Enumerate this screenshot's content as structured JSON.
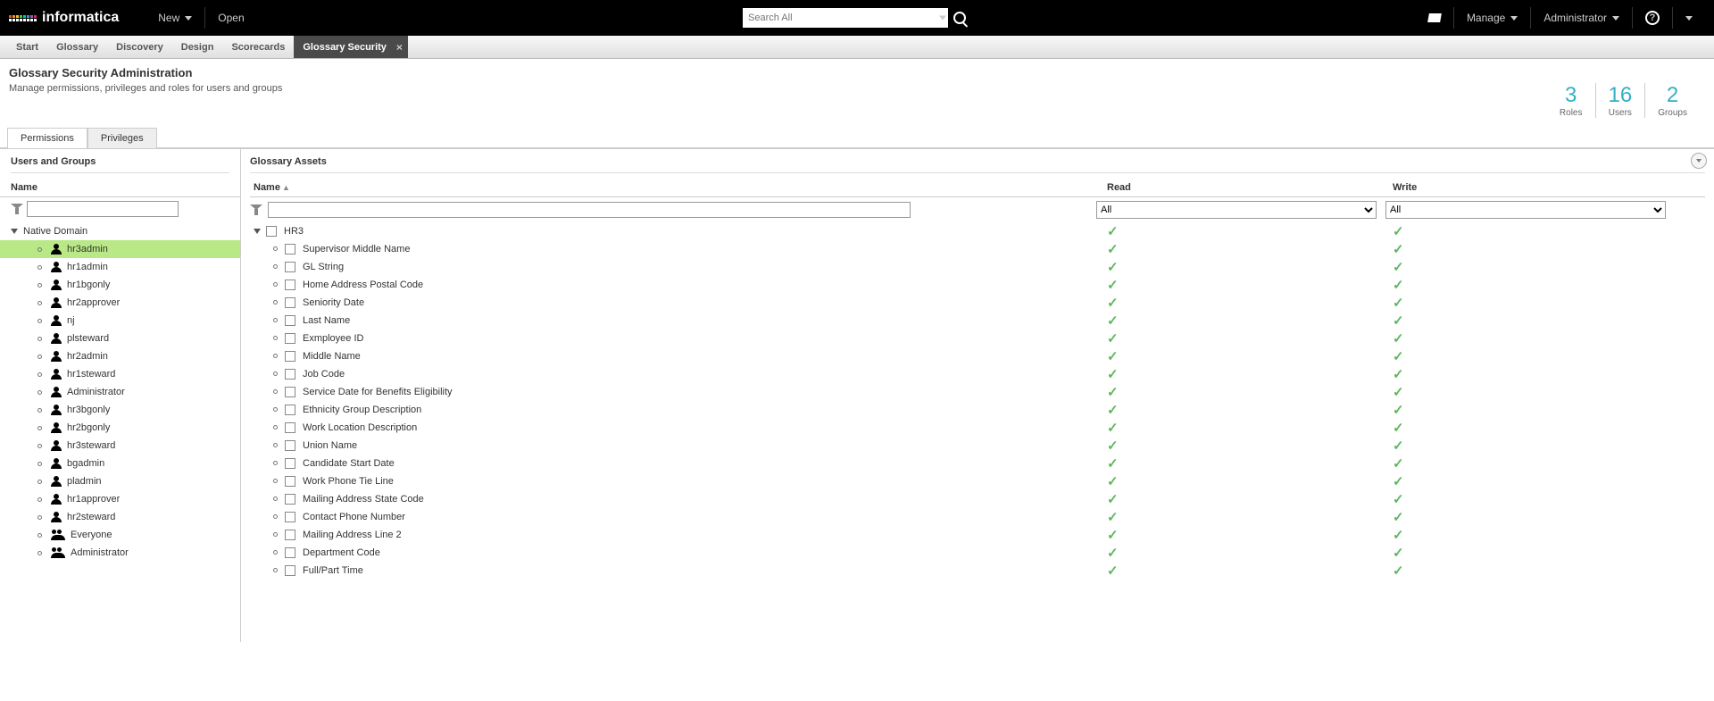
{
  "header": {
    "brand": "informatica",
    "new_label": "New",
    "open_label": "Open",
    "search_placeholder": "Search All",
    "manage_label": "Manage",
    "admin_label": "Administrator",
    "help_glyph": "?"
  },
  "nav": {
    "tabs": [
      {
        "label": "Start",
        "active": false
      },
      {
        "label": "Glossary",
        "active": false
      },
      {
        "label": "Discovery",
        "active": false
      },
      {
        "label": "Design",
        "active": false
      },
      {
        "label": "Scorecards",
        "active": false
      },
      {
        "label": "Glossary Security",
        "active": true
      }
    ]
  },
  "page": {
    "title": "Glossary Security Administration",
    "subtitle": "Manage permissions, privileges and roles for users and groups",
    "stats": [
      {
        "num": "3",
        "label": "Roles"
      },
      {
        "num": "16",
        "label": "Users"
      },
      {
        "num": "2",
        "label": "Groups"
      }
    ],
    "subtabs": [
      {
        "label": "Permissions",
        "active": true
      },
      {
        "label": "Privileges",
        "active": false
      }
    ]
  },
  "left": {
    "title": "Users and Groups",
    "name_header": "Name",
    "domain": "Native Domain",
    "items": [
      {
        "name": "hr3admin",
        "type": "user",
        "selected": true
      },
      {
        "name": "hr1admin",
        "type": "user"
      },
      {
        "name": "hr1bgonly",
        "type": "user"
      },
      {
        "name": "hr2approver",
        "type": "user"
      },
      {
        "name": "nj",
        "type": "user"
      },
      {
        "name": "plsteward",
        "type": "user"
      },
      {
        "name": "hr2admin",
        "type": "user"
      },
      {
        "name": "hr1steward",
        "type": "user"
      },
      {
        "name": "Administrator",
        "type": "user"
      },
      {
        "name": "hr3bgonly",
        "type": "user"
      },
      {
        "name": "hr2bgonly",
        "type": "user"
      },
      {
        "name": "hr3steward",
        "type": "user"
      },
      {
        "name": "bgadmin",
        "type": "user"
      },
      {
        "name": "pladmin",
        "type": "user"
      },
      {
        "name": "hr1approver",
        "type": "user"
      },
      {
        "name": "hr2steward",
        "type": "user"
      },
      {
        "name": "Everyone",
        "type": "group"
      },
      {
        "name": "Administrator",
        "type": "group"
      }
    ]
  },
  "right": {
    "title": "Glossary Assets",
    "name_header": "Name",
    "read_header": "Read",
    "write_header": "Write",
    "read_filter": "All",
    "write_filter": "All",
    "root": "HR3",
    "rows": [
      {
        "name": "Supervisor Middle Name",
        "read": true,
        "write": true
      },
      {
        "name": "GL String",
        "read": true,
        "write": true
      },
      {
        "name": "Home Address Postal Code",
        "read": true,
        "write": true
      },
      {
        "name": "Seniority Date",
        "read": true,
        "write": true
      },
      {
        "name": "Last Name",
        "read": true,
        "write": true
      },
      {
        "name": "Exmployee ID",
        "read": true,
        "write": true
      },
      {
        "name": "Middle Name",
        "read": true,
        "write": true
      },
      {
        "name": "Job Code",
        "read": true,
        "write": true
      },
      {
        "name": "Service Date for Benefits Eligibility",
        "read": true,
        "write": true
      },
      {
        "name": "Ethnicity Group Description",
        "read": true,
        "write": true
      },
      {
        "name": "Work Location Description",
        "read": true,
        "write": true
      },
      {
        "name": "Union Name",
        "read": true,
        "write": true
      },
      {
        "name": "Candidate Start Date",
        "read": true,
        "write": true
      },
      {
        "name": "Work Phone Tie Line",
        "read": true,
        "write": true
      },
      {
        "name": "Mailing Address State Code",
        "read": true,
        "write": true
      },
      {
        "name": "Contact Phone Number",
        "read": true,
        "write": true
      },
      {
        "name": "Mailing Address Line 2",
        "read": true,
        "write": true
      },
      {
        "name": "Department Code",
        "read": true,
        "write": true
      },
      {
        "name": "Full/Part Time",
        "read": true,
        "write": true
      }
    ]
  }
}
